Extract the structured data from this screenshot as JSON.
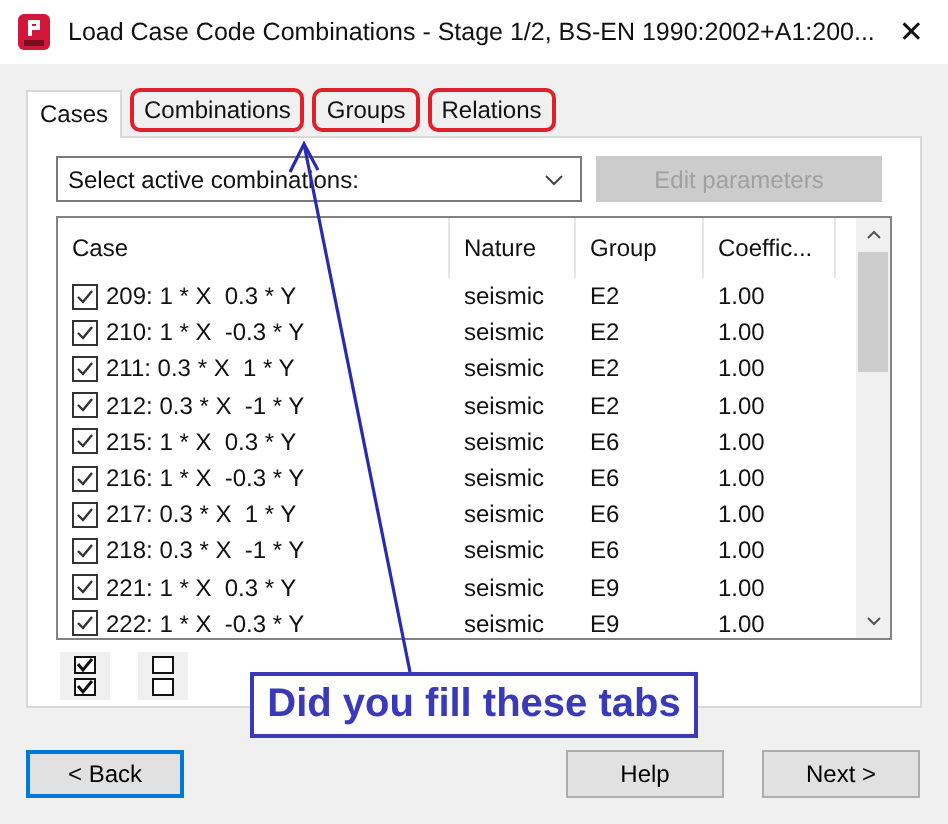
{
  "window": {
    "title": "Load Case Code Combinations - Stage 1/2, BS-EN 1990:2002+A1:200...",
    "close": "✕"
  },
  "tabs": [
    {
      "label": "Cases",
      "selected": true,
      "highlighted": false
    },
    {
      "label": "Combinations",
      "selected": false,
      "highlighted": true
    },
    {
      "label": "Groups",
      "selected": false,
      "highlighted": true
    },
    {
      "label": "Relations",
      "selected": false,
      "highlighted": true
    }
  ],
  "combo": {
    "value": "Select active combinations:"
  },
  "edit_button": {
    "label": "Edit parameters",
    "disabled": true
  },
  "table": {
    "columns": [
      "Case",
      "Nature",
      "Group",
      "Coeffic..."
    ],
    "rows": [
      {
        "checked": true,
        "cells": [
          "209: 1 * X  0.3 * Y",
          "seismic",
          "E2",
          "1.00"
        ]
      },
      {
        "checked": true,
        "cells": [
          "210: 1 * X  -0.3 * Y",
          "seismic",
          "E2",
          "1.00"
        ]
      },
      {
        "checked": true,
        "cells": [
          "211: 0.3 * X  1 * Y",
          "seismic",
          "E2",
          "1.00"
        ]
      },
      {
        "checked": true,
        "cells": [
          "212: 0.3 * X  -1 * Y",
          "seismic",
          "E2",
          "1.00"
        ]
      },
      {
        "checked": true,
        "cells": [
          "215: 1 * X  0.3 * Y",
          "seismic",
          "E6",
          "1.00"
        ]
      },
      {
        "checked": true,
        "cells": [
          "216: 1 * X  -0.3 * Y",
          "seismic",
          "E6",
          "1.00"
        ]
      },
      {
        "checked": true,
        "cells": [
          "217: 0.3 * X  1 * Y",
          "seismic",
          "E6",
          "1.00"
        ]
      },
      {
        "checked": true,
        "cells": [
          "218: 0.3 * X  -1 * Y",
          "seismic",
          "E6",
          "1.00"
        ]
      },
      {
        "checked": true,
        "cells": [
          "221: 1 * X  0.3 * Y",
          "seismic",
          "E9",
          "1.00"
        ]
      },
      {
        "checked": true,
        "cells": [
          "222: 1 * X  -0.3 * Y",
          "seismic",
          "E9",
          "1.00"
        ]
      }
    ]
  },
  "callout": {
    "text": "Did you fill these tabs"
  },
  "buttons": [
    {
      "label": "< Back",
      "focused": true
    },
    {
      "label": "Help",
      "focused": false
    },
    {
      "label": "Next >",
      "focused": false
    }
  ]
}
